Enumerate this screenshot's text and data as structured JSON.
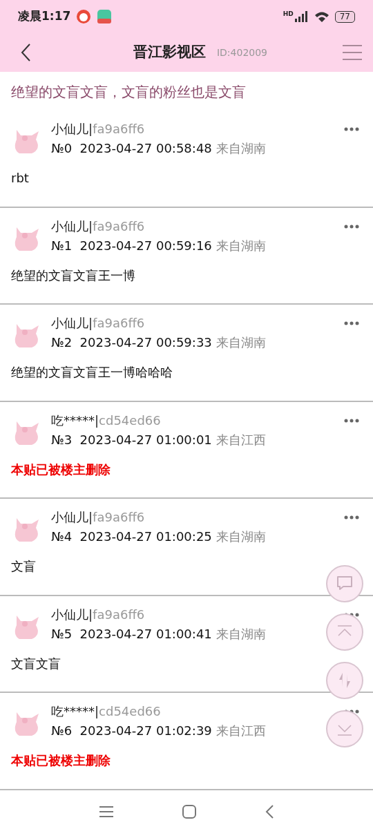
{
  "status_bar": {
    "time": "凌晨1:17",
    "network": "HD",
    "battery": "77"
  },
  "header": {
    "title": "晋江影视区",
    "id": "ID:402009"
  },
  "thread_title": "绝望的文盲文盲，文盲的粉丝也是文盲",
  "posts": [
    {
      "kind": "normal",
      "name": "小仙儿|",
      "uid": "fa9a6ff6",
      "floor": "№0",
      "time": "2023-04-27 00:58:48",
      "location": "来自湖南",
      "body": "rbt"
    },
    {
      "kind": "normal",
      "name": "小仙儿|",
      "uid": "fa9a6ff6",
      "floor": "№1",
      "time": "2023-04-27 00:59:16",
      "location": "来自湖南",
      "body": "绝望的文盲文盲王一博"
    },
    {
      "kind": "normal",
      "name": "小仙儿|",
      "uid": "fa9a6ff6",
      "floor": "№2",
      "time": "2023-04-27 00:59:33",
      "location": "来自湖南",
      "body": "绝望的文盲文盲王一博哈哈哈"
    },
    {
      "kind": "deleted",
      "name": "吃*****|",
      "uid": "cd54ed66",
      "floor": "№3",
      "time": "2023-04-27 01:00:01",
      "location": "来自江西",
      "body": "本贴已被楼主删除"
    },
    {
      "kind": "normal",
      "name": "小仙儿|",
      "uid": "fa9a6ff6",
      "floor": "№4",
      "time": "2023-04-27 01:00:25",
      "location": "来自湖南",
      "body": "文盲"
    },
    {
      "kind": "normal",
      "name": "小仙儿|",
      "uid": "fa9a6ff6",
      "floor": "№5",
      "time": "2023-04-27 01:00:41",
      "location": "来自湖南",
      "body": "文盲文盲"
    },
    {
      "kind": "deleted",
      "name": "吃*****|",
      "uid": "cd54ed66",
      "floor": "№6",
      "time": "2023-04-27 01:02:39",
      "location": "来自江西",
      "body": "本贴已被楼主删除"
    }
  ]
}
